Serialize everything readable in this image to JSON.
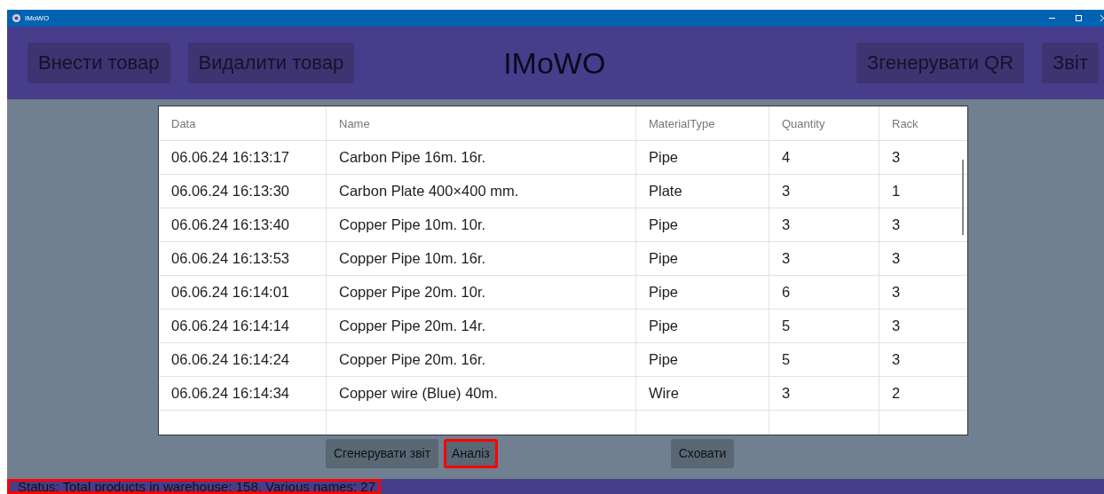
{
  "window": {
    "title": "IMoWO"
  },
  "header": {
    "left_buttons": [
      {
        "label": "Внести товар"
      },
      {
        "label": "Видалити товар"
      }
    ],
    "title": "IMoWO",
    "right_buttons": [
      {
        "label": "Згенерувати QR"
      },
      {
        "label": "Звіт"
      }
    ]
  },
  "table": {
    "columns": [
      "Data",
      "Name",
      "MaterialType",
      "Quantity",
      "Rack"
    ],
    "rows": [
      [
        "06.06.24 16:13:17",
        "Carbon Pipe 16m. 16r.",
        "Pipe",
        "4",
        "3"
      ],
      [
        "06.06.24 16:13:30",
        "Carbon Plate 400×400 mm.",
        "Plate",
        "3",
        "1"
      ],
      [
        "06.06.24 16:13:40",
        "Copper Pipe 10m. 10r.",
        "Pipe",
        "3",
        "3"
      ],
      [
        "06.06.24 16:13:53",
        "Copper Pipe 10m. 16r.",
        "Pipe",
        "3",
        "3"
      ],
      [
        "06.06.24 16:14:01",
        "Copper Pipe 20m. 10r.",
        "Pipe",
        "6",
        "3"
      ],
      [
        "06.06.24 16:14:14",
        "Copper Pipe 20m. 14r.",
        "Pipe",
        "5",
        "3"
      ],
      [
        "06.06.24 16:14:24",
        "Copper Pipe 20m. 16r.",
        "Pipe",
        "5",
        "3"
      ],
      [
        "06.06.24 16:14:34",
        "Copper wire (Blue) 40m.",
        "Wire",
        "3",
        "2"
      ]
    ]
  },
  "actions": [
    {
      "label": "Сгенерувати звіт",
      "highlighted": false
    },
    {
      "label": "Аналіз",
      "highlighted": true
    },
    {
      "label": "Сховати",
      "highlighted": false
    }
  ],
  "status_bar": {
    "text": "Status: Total products in warehouse: 158. Various names: 27",
    "highlighted": true
  }
}
